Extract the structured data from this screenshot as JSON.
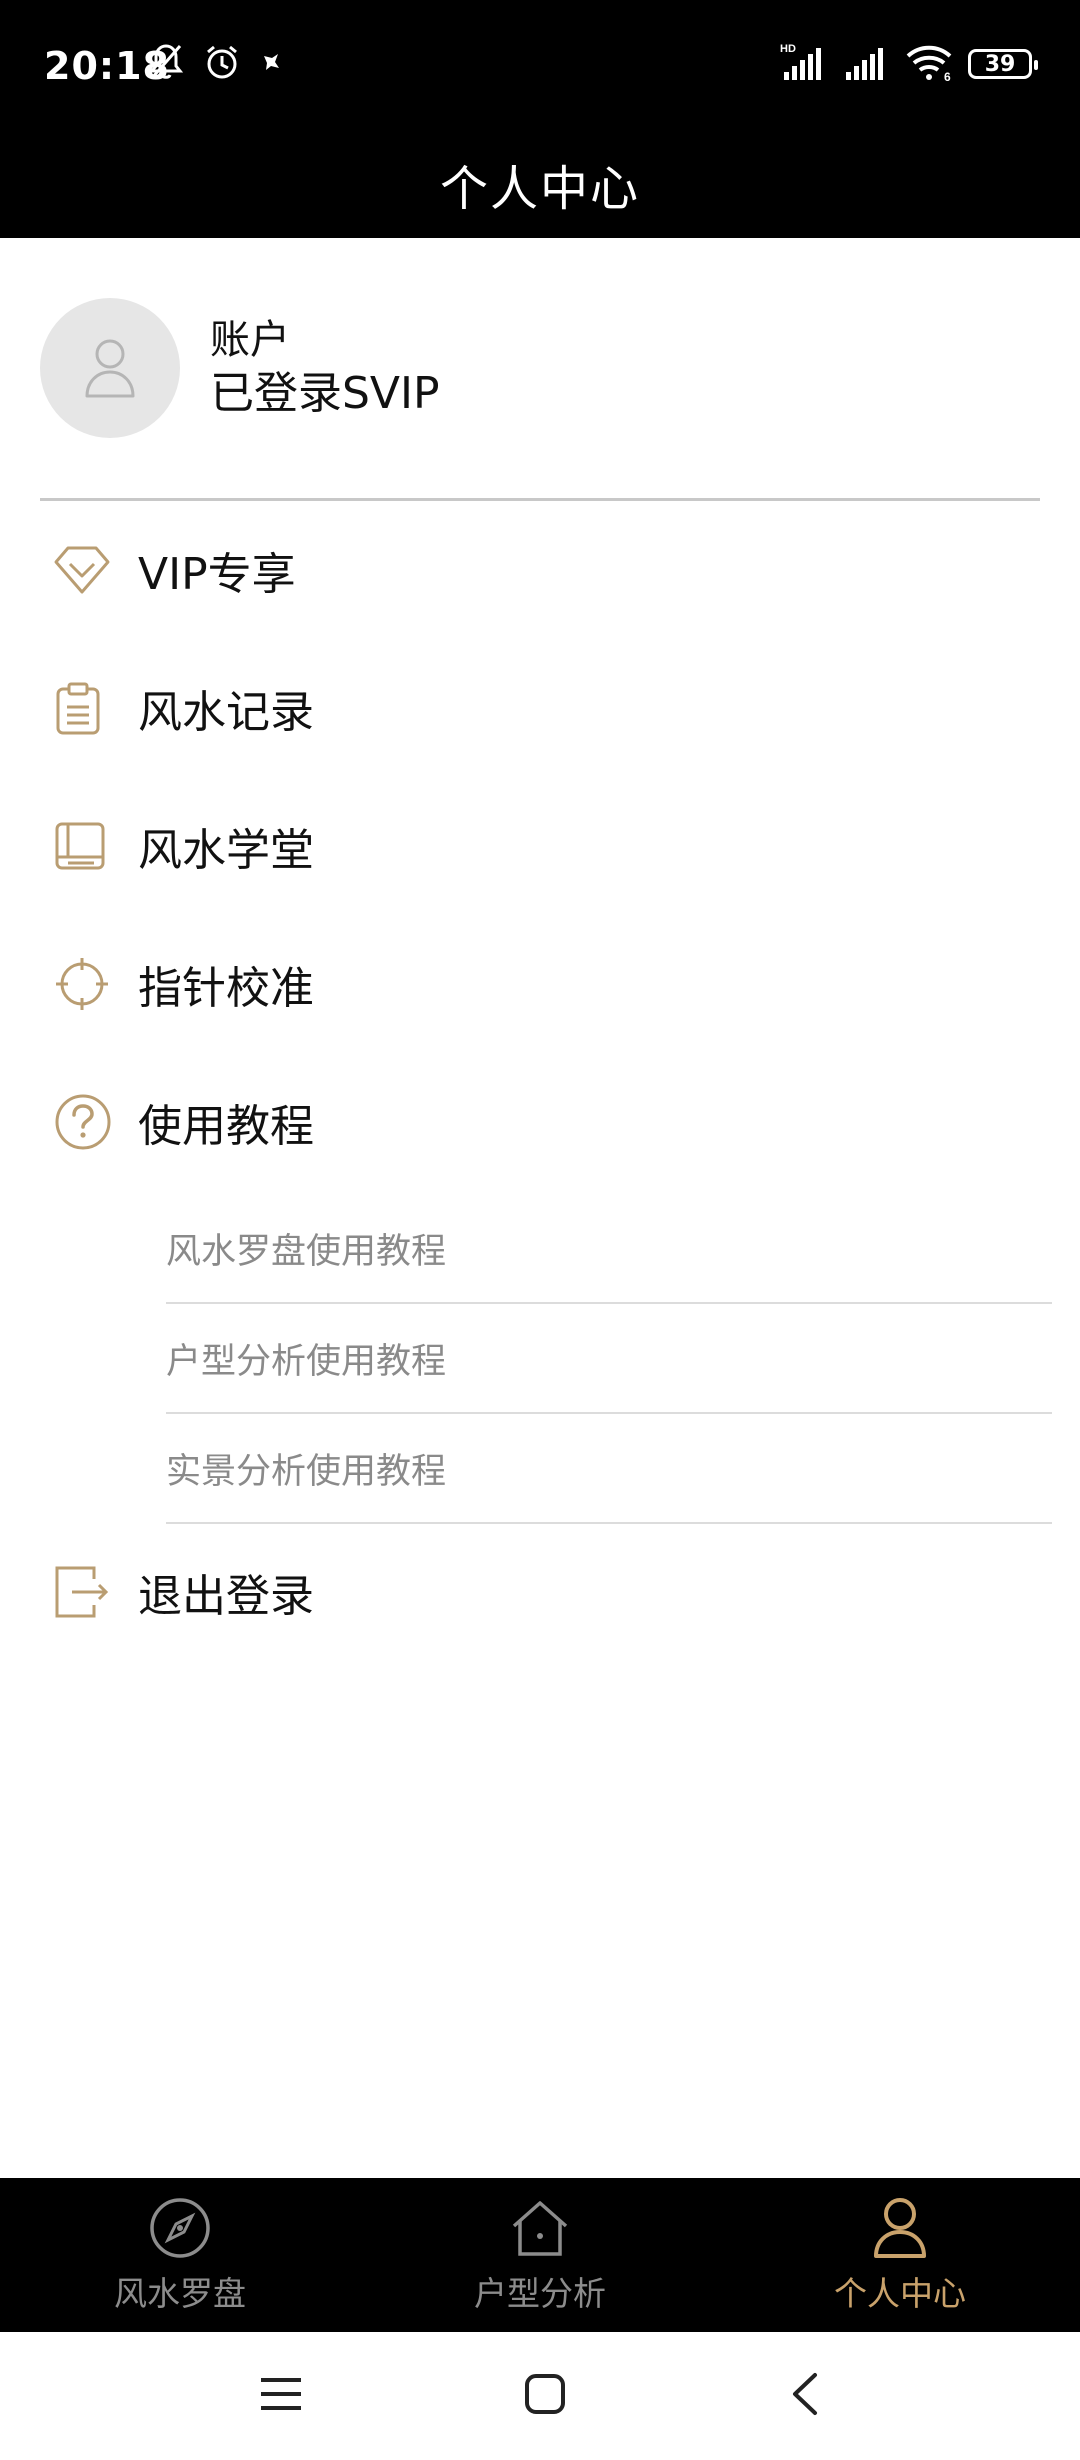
{
  "status_bar": {
    "time": "20:18",
    "battery": "39",
    "network_badge": "HD",
    "wifi_badge": "6"
  },
  "header": {
    "title": "个人中心"
  },
  "account": {
    "label": "账户",
    "status": "已登录SVIP"
  },
  "menu": {
    "vip": "VIP专享",
    "records": "风水记录",
    "school": "风水学堂",
    "calibrate": "指针校准",
    "tutorial": "使用教程",
    "logout": "退出登录"
  },
  "tutorials": [
    "风水罗盘使用教程",
    "户型分析使用教程",
    "实景分析使用教程"
  ],
  "bottom_nav": {
    "tabs": [
      {
        "label": "风水罗盘",
        "icon": "compass-icon"
      },
      {
        "label": "户型分析",
        "icon": "house-icon"
      },
      {
        "label": "个人中心",
        "icon": "person-icon"
      }
    ],
    "active_index": 2
  },
  "colors": {
    "accent": "#c9a26b",
    "header_bg": "#000000",
    "icon_gold": "#b99d72"
  }
}
